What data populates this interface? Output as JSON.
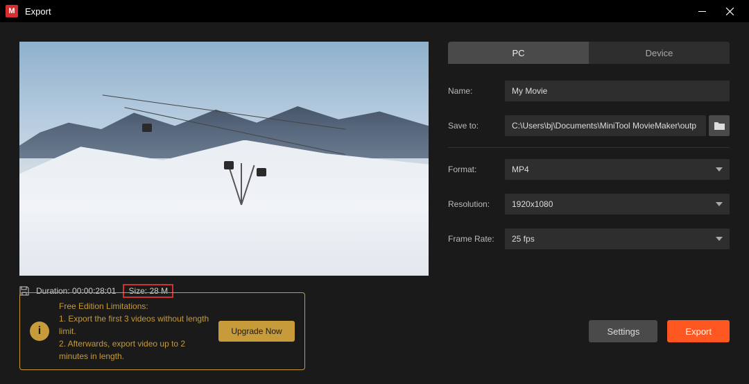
{
  "window": {
    "title": "Export"
  },
  "tabs": {
    "pc": "PC",
    "device": "Device"
  },
  "form": {
    "name_label": "Name:",
    "name_value": "My Movie",
    "save_label": "Save to:",
    "save_value": "C:\\Users\\bj\\Documents\\MiniTool MovieMaker\\outp",
    "format_label": "Format:",
    "format_value": "MP4",
    "resolution_label": "Resolution:",
    "resolution_value": "1920x1080",
    "framerate_label": "Frame Rate:",
    "framerate_value": "25 fps"
  },
  "info": {
    "duration_label": "Duration:",
    "duration_value": "00:00:28:01",
    "size_label": "Size:",
    "size_value": "28 M"
  },
  "limits": {
    "title": "Free Edition Limitations:",
    "line1": "1. Export the first 3 videos without length limit.",
    "line2": "2. Afterwards, export video up to 2 minutes in length.",
    "upgrade": "Upgrade Now"
  },
  "buttons": {
    "settings": "Settings",
    "export": "Export"
  }
}
